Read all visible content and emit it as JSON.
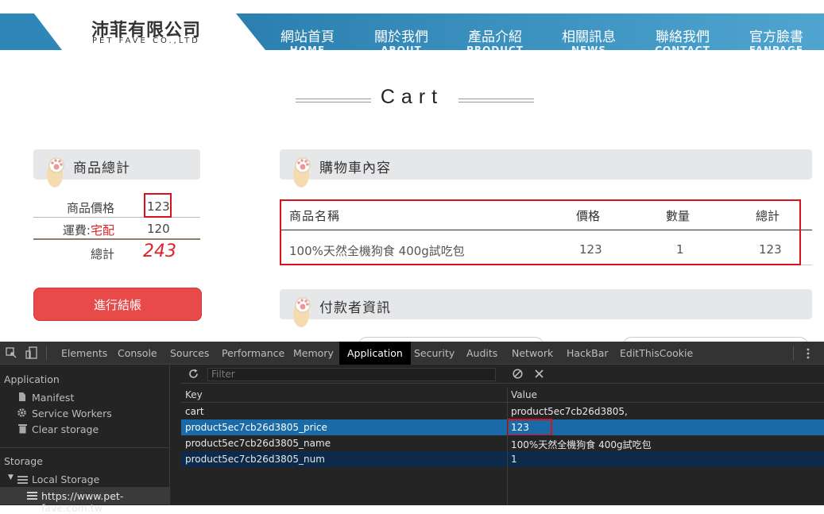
{
  "header": {
    "logo_cn": "沛菲有限公司",
    "logo_en": "PET FAVE CO.,LTD",
    "nav": [
      {
        "cn": "網站首頁",
        "en": "HOME"
      },
      {
        "cn": "關於我們",
        "en": "ABOUT"
      },
      {
        "cn": "產品介紹",
        "en": "PRODUCT"
      },
      {
        "cn": "相關訊息",
        "en": "NEWS"
      },
      {
        "cn": "聯絡我們",
        "en": "CONTACT"
      },
      {
        "cn": "官方臉書",
        "en": "FANPAGE"
      }
    ]
  },
  "page_title": "Cart",
  "summary": {
    "heading": "商品總計",
    "price_label": "商品價格",
    "price_value": "123",
    "shipping_label": "運費:",
    "shipping_method": "宅配",
    "shipping_value": "120",
    "total_label": "總計",
    "total_value": "243",
    "checkout_label": "進行結帳"
  },
  "cart": {
    "heading": "購物車內容",
    "columns": [
      "商品名稱",
      "價格",
      "數量",
      "總計"
    ],
    "rows": [
      {
        "name": "100%天然全機狗食 400g試吃包",
        "price": "123",
        "qty": "1",
        "total": "123"
      }
    ]
  },
  "payer": {
    "heading": "付款者資訊"
  },
  "devtools": {
    "tabs": [
      "Elements",
      "Console",
      "Sources",
      "Performance",
      "Memory",
      "Application",
      "Security",
      "Audits",
      "Network",
      "HackBar",
      "EditThisCookie"
    ],
    "active_tab": "Application",
    "sidebar": {
      "application_heading": "Application",
      "app_items": [
        "Manifest",
        "Service Workers",
        "Clear storage"
      ],
      "storage_heading": "Storage",
      "local_storage": "Local Storage",
      "origin": "https://www.pet-fave.com.tw"
    },
    "filter_placeholder": "Filter",
    "table": {
      "key_header": "Key",
      "value_header": "Value",
      "rows": [
        {
          "key": "cart",
          "value": "product5ec7cb26d3805,"
        },
        {
          "key": "product5ec7cb26d3805_price",
          "value": "123"
        },
        {
          "key": "product5ec7cb26d3805_name",
          "value": "100%天然全機狗食 400g試吃包"
        },
        {
          "key": "product5ec7cb26d3805_num",
          "value": "1"
        }
      ]
    }
  },
  "colors": {
    "brand_blue": "#2f86b8",
    "accent_red": "#d9252a",
    "checkout_red": "#e84a4a",
    "devtools_selected": "#1a6aa8"
  }
}
